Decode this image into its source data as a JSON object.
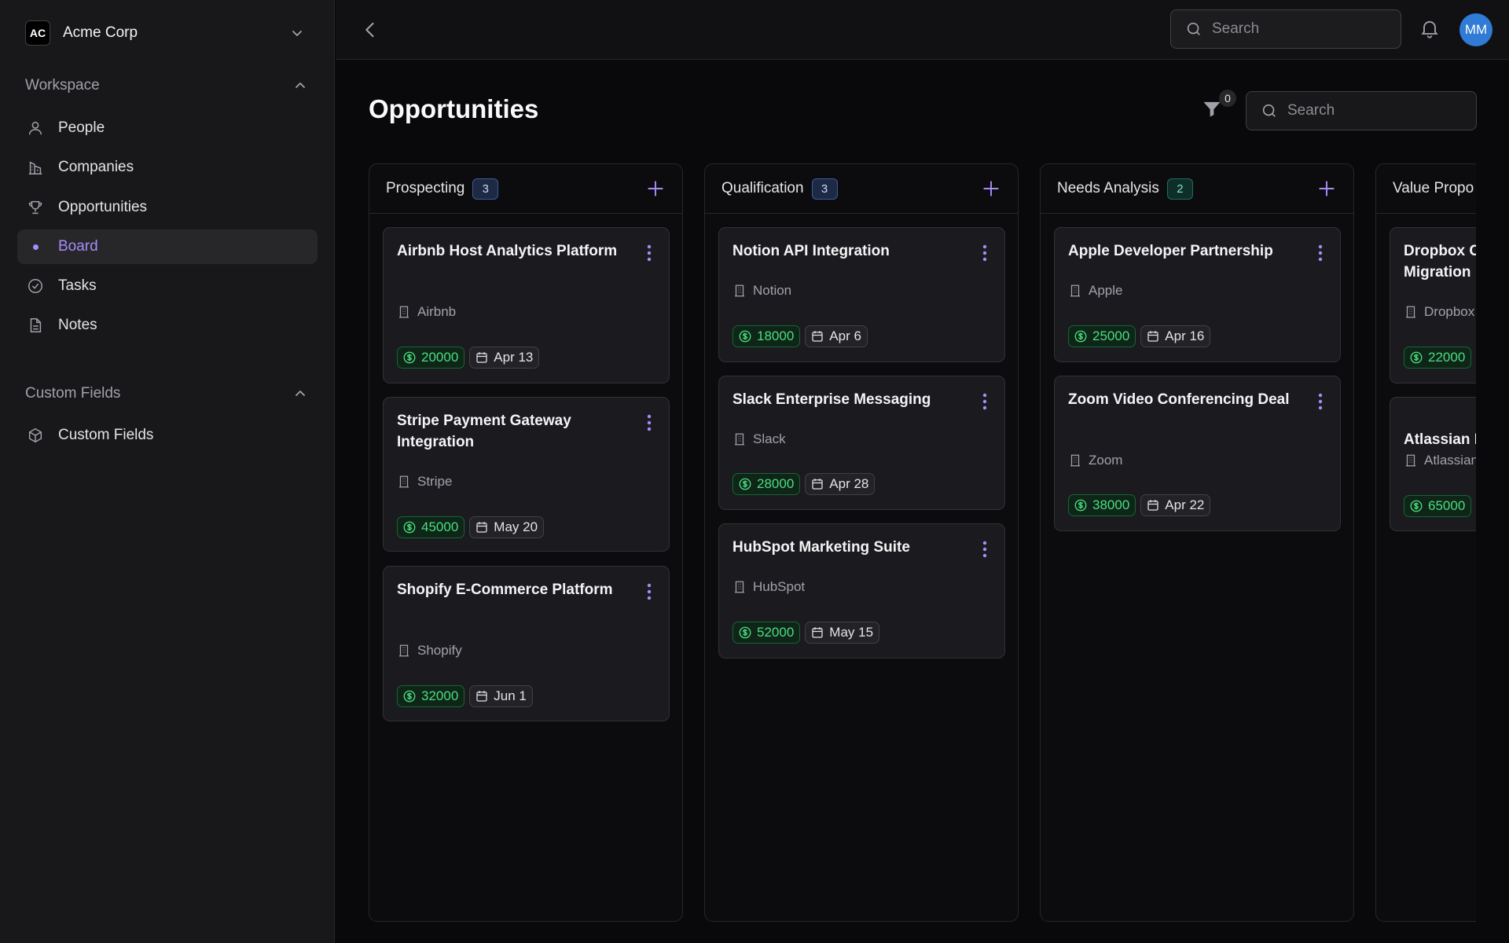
{
  "sidebar": {
    "org": {
      "initials": "AC",
      "name": "Acme Corp"
    },
    "workspace_label": "Workspace",
    "items": [
      {
        "label": "People",
        "icon": "person-icon"
      },
      {
        "label": "Companies",
        "icon": "companies-icon"
      },
      {
        "label": "Opportunities",
        "icon": "trophy-icon"
      },
      {
        "label": "Board",
        "icon": "dot-icon",
        "active": true
      },
      {
        "label": "Tasks",
        "icon": "check-circle-icon"
      },
      {
        "label": "Notes",
        "icon": "document-icon"
      }
    ],
    "custom_fields_label": "Custom Fields",
    "custom_items": [
      {
        "label": "Custom Fields",
        "icon": "cube-icon"
      }
    ]
  },
  "topbar": {
    "search_placeholder": "Search",
    "avatar_initials": "MM"
  },
  "page": {
    "title": "Opportunities",
    "filter_count": "0",
    "search_placeholder": "Search"
  },
  "colors": {
    "accent": "#a78bfa",
    "money": "#4ade80",
    "avatar": "#2f7bd6"
  },
  "board": {
    "columns": [
      {
        "title": "Prospecting",
        "count": "3",
        "cards": [
          {
            "title": "Airbnb Host Analytics Platform",
            "company": "Airbnb",
            "amount": "20000",
            "date": "Apr 13"
          },
          {
            "title": "Stripe Payment Gateway Integration",
            "company": "Stripe",
            "amount": "45000",
            "date": "May 20"
          },
          {
            "title": "Shopify E-Commerce Platform",
            "company": "Shopify",
            "amount": "32000",
            "date": "Jun 1"
          }
        ]
      },
      {
        "title": "Qualification",
        "count": "3",
        "cards": [
          {
            "title": "Notion API Integration",
            "company": "Notion",
            "amount": "18000",
            "date": "Apr 6"
          },
          {
            "title": "Slack Enterprise Messaging",
            "company": "Slack",
            "amount": "28000",
            "date": "Apr 28"
          },
          {
            "title": "HubSpot Marketing Suite",
            "company": "HubSpot",
            "amount": "52000",
            "date": "May 15"
          }
        ]
      },
      {
        "title": "Needs Analysis",
        "count": "2",
        "cards": [
          {
            "title": "Apple Developer Partnership",
            "company": "Apple",
            "amount": "25000",
            "date": "Apr 16"
          },
          {
            "title": "Zoom Video Conferencing Deal",
            "company": "Zoom",
            "amount": "38000",
            "date": "Apr 22"
          }
        ]
      },
      {
        "title": "Value Propo",
        "cards": [
          {
            "title": "Dropbox C Migration",
            "company": "Dropbox",
            "amount": "22000"
          },
          {
            "title": "Atlassian D",
            "company": "Atlassian",
            "amount": "65000"
          }
        ]
      }
    ]
  }
}
